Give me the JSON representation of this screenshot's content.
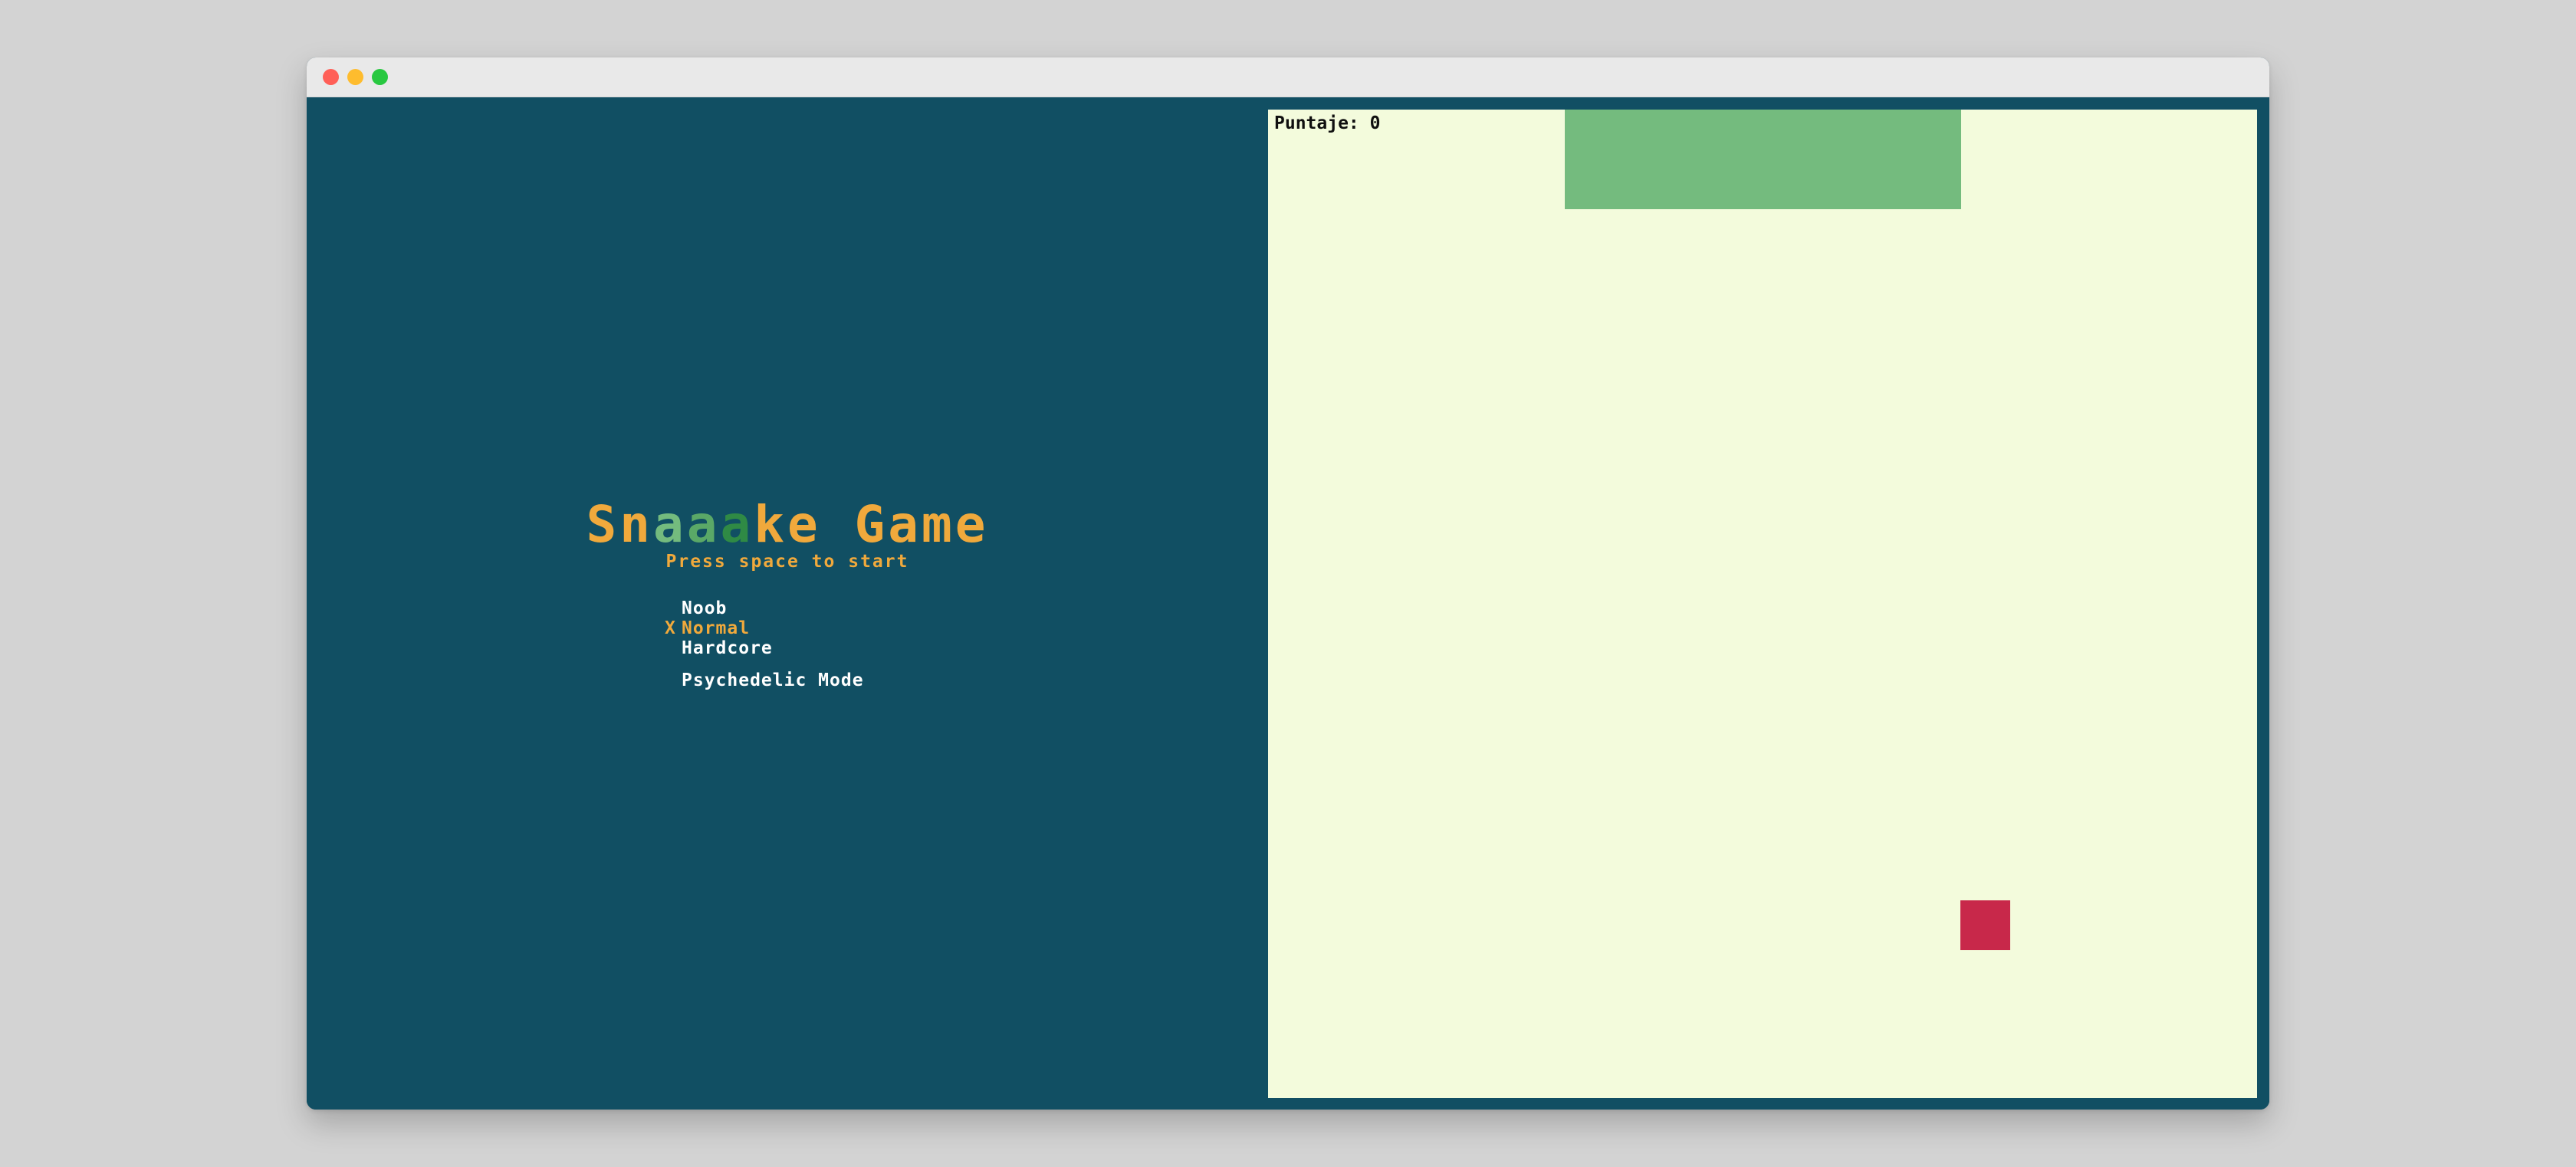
{
  "colors": {
    "page_background": "#d3d3d3",
    "titlebar": "#e9e9e9",
    "traffic_close": "#ff5f57",
    "traffic_minimize": "#febc2e",
    "traffic_maximize": "#28c840",
    "menu_background": "#114f63",
    "accent_orange": "#f0a93c",
    "menu_text": "#ffffff",
    "board_background": "#f3fbdc",
    "snake": "#74bb7e",
    "food": "#c8284a",
    "score_text": "#0f0f0f"
  },
  "window": {
    "controls": [
      "close",
      "minimize",
      "maximize"
    ]
  },
  "menu": {
    "title_letters": [
      {
        "char": "S",
        "color": "#f0a93c"
      },
      {
        "char": "n",
        "color": "#f0a93c"
      },
      {
        "char": "a",
        "color": "#74bb7e"
      },
      {
        "char": "a",
        "color": "#5aa867"
      },
      {
        "char": "a",
        "color": "#2f8a45"
      },
      {
        "char": "k",
        "color": "#f0a93c"
      },
      {
        "char": "e",
        "color": "#f0a93c"
      },
      {
        "char": " ",
        "color": "#f0a93c"
      },
      {
        "char": "G",
        "color": "#f0a93c"
      },
      {
        "char": "a",
        "color": "#f0a93c"
      },
      {
        "char": "m",
        "color": "#f0a93c"
      },
      {
        "char": "e",
        "color": "#f0a93c"
      }
    ],
    "subtitle": "Press space to start",
    "difficulty_options": [
      {
        "label": "Noob",
        "selected": false
      },
      {
        "label": "Normal",
        "selected": true
      },
      {
        "label": "Hardcore",
        "selected": false
      }
    ],
    "selected_marker": "X",
    "psychedelic_label": "Psychedelic Mode"
  },
  "game": {
    "score_label": "Puntaje:",
    "score_value": "0",
    "grid_size": 20,
    "snake_cells": [
      {
        "col": 6,
        "row": 0
      },
      {
        "col": 7,
        "row": 0
      },
      {
        "col": 8,
        "row": 0
      },
      {
        "col": 9,
        "row": 0
      },
      {
        "col": 10,
        "row": 0
      },
      {
        "col": 11,
        "row": 0
      },
      {
        "col": 12,
        "row": 0
      },
      {
        "col": 13,
        "row": 0
      },
      {
        "col": 6,
        "row": 1
      },
      {
        "col": 7,
        "row": 1
      },
      {
        "col": 8,
        "row": 1
      },
      {
        "col": 9,
        "row": 1
      },
      {
        "col": 10,
        "row": 1
      },
      {
        "col": 11,
        "row": 1
      },
      {
        "col": 12,
        "row": 1
      },
      {
        "col": 13,
        "row": 1
      }
    ],
    "food_cell": {
      "col": 14,
      "row": 16
    }
  }
}
